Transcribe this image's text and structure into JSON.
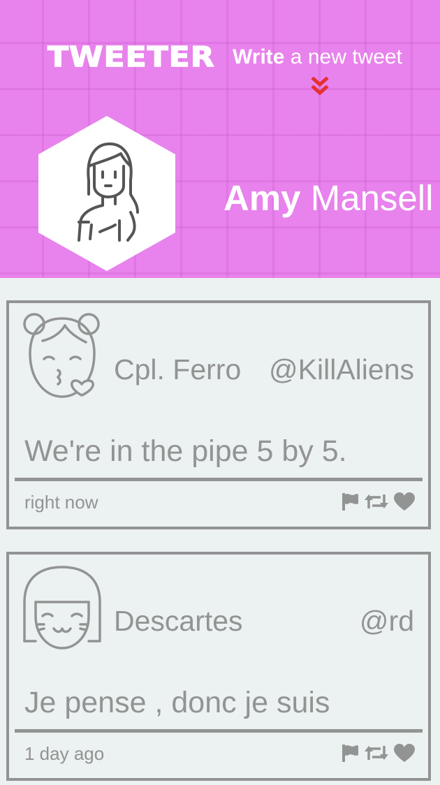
{
  "header": {
    "brand": "TWEETER",
    "write_bold": "Write",
    "write_rest": " a new tweet",
    "user_first": "Amy",
    "user_last": " Mansell"
  },
  "colors": {
    "header_bg": "#e882ec",
    "page_bg": "#ecf1f1",
    "card_gray": "#929493",
    "chevron": "#e5302f"
  },
  "icons": [
    "chevron-double-down-icon",
    "flag-icon",
    "retweet-icon",
    "heart-icon"
  ],
  "tweets": [
    {
      "author": "Cpl. Ferro",
      "handle": "@KillAliens",
      "content": "We're in the pipe 5 by 5.",
      "time": "right now"
    },
    {
      "author": "Descartes",
      "handle": "@rd",
      "content": "Je pense , donc je suis",
      "time": "1 day ago"
    }
  ]
}
